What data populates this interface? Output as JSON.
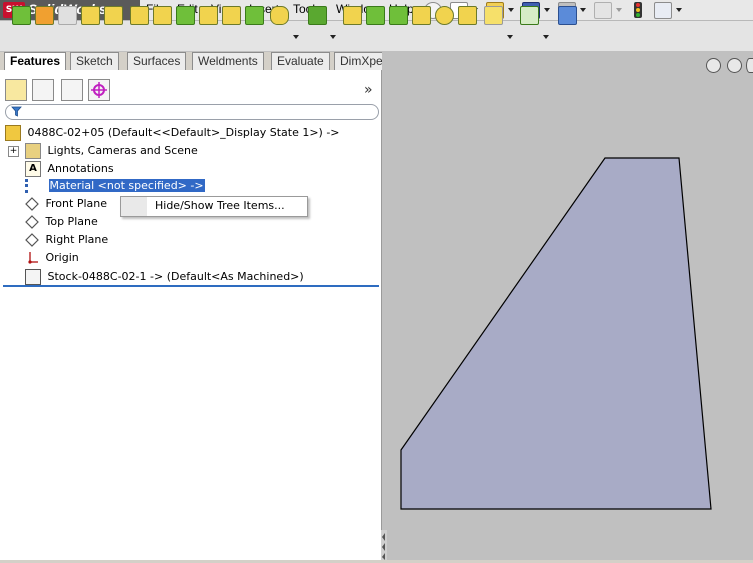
{
  "app": {
    "logo_mark": "SW",
    "name": "SolidWorks"
  },
  "menu": [
    {
      "label": "File"
    },
    {
      "label": "Edit"
    },
    {
      "label": "View"
    },
    {
      "label": "Insert"
    },
    {
      "label": "Tools"
    },
    {
      "label": "Window"
    },
    {
      "label": "Help"
    }
  ],
  "quick_access_icons": [
    "pin-icon",
    "new-document-icon",
    "open-folder-icon",
    "save-icon",
    "print-icon",
    "undo-icon",
    "traffic-light-icon",
    "options-icon"
  ],
  "toolbar_icons": [
    "sketch-icon",
    "move-icon",
    "revolve-icon",
    "fillet-icon",
    "chamfer-icon",
    "shell-icon",
    "wrap-icon",
    "rib-icon",
    "draft-icon",
    "dome-icon",
    "cut-icon",
    "shape-icon",
    "linear-pattern-icon",
    "loft-icon",
    "extrude-icon",
    "sweep-icon",
    "cylinder-icon",
    "sphere-icon",
    "boundary-icon",
    "curves-icon",
    "instant3d-icon",
    "reference-icon"
  ],
  "tabs": [
    {
      "label": "Features",
      "active": true
    },
    {
      "label": "Sketch",
      "active": false
    },
    {
      "label": "Surfaces",
      "active": false
    },
    {
      "label": "Weldments",
      "active": false
    },
    {
      "label": "Evaluate",
      "active": false
    },
    {
      "label": "DimXpert",
      "active": false
    }
  ],
  "panel_tools": [
    "feature-manager-icon",
    "property-manager-icon",
    "configuration-manager-icon",
    "dimxpert-manager-icon"
  ],
  "panel_expand": "»",
  "tree": {
    "root": "0488C-02+05  (Default<<Default>_Display State 1>) ->",
    "items": [
      {
        "label": "Lights, Cameras and Scene",
        "icon": "lights-cameras-icon",
        "expandable": true
      },
      {
        "label": "Annotations",
        "icon": "annotations-icon",
        "expandable": false
      },
      {
        "label": "Material <not specified> ->",
        "icon": "material-icon",
        "expandable": false,
        "selected": true
      },
      {
        "label": "Front Plane",
        "icon": "plane-icon",
        "expandable": false
      },
      {
        "label": "Top Plane",
        "icon": "plane-icon",
        "expandable": false
      },
      {
        "label": "Right Plane",
        "icon": "plane-icon",
        "expandable": false
      },
      {
        "label": "Origin",
        "icon": "origin-icon",
        "expandable": false
      },
      {
        "label": "Stock-0488C-02-1 -> (Default<As Machined>)",
        "icon": "stock-part-icon",
        "expandable": false
      }
    ]
  },
  "context_menu": {
    "items": [
      {
        "label": "Hide/Show Tree Items..."
      }
    ]
  },
  "viewport": {
    "background": "#c0c0c0",
    "shape_fill": "#a8abc6",
    "shape_stroke": "#000000"
  }
}
